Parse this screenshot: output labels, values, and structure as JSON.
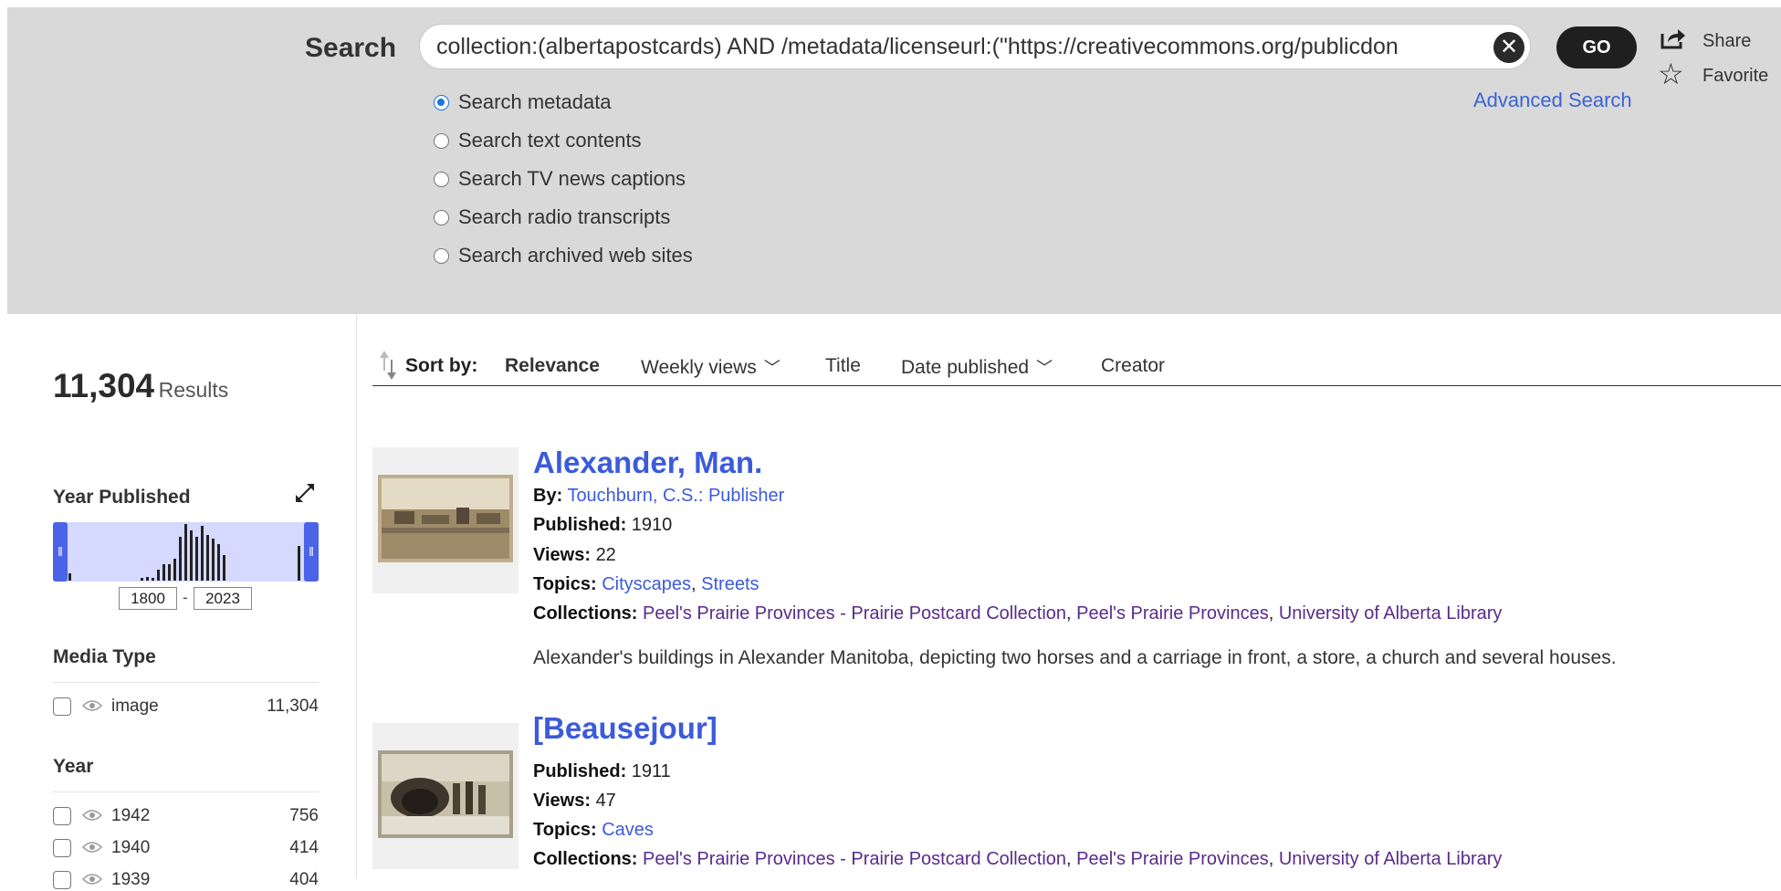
{
  "search": {
    "label": "Search",
    "query": "collection:(albertapostcards) AND /metadata/licenseurl:(\"https://creativecommons.org/publicdon",
    "clear_symbol": "✕",
    "go_label": "GO",
    "share_label": "Share",
    "favorite_label": "Favorite",
    "favorite_symbol": "☆",
    "advanced_label": "Advanced Search",
    "options": [
      {
        "label": "Search metadata",
        "selected": true
      },
      {
        "label": "Search text contents",
        "selected": false
      },
      {
        "label": "Search TV news captions",
        "selected": false
      },
      {
        "label": "Search radio transcripts",
        "selected": false
      },
      {
        "label": "Search archived web sites",
        "selected": false
      }
    ]
  },
  "results": {
    "count": "11,304",
    "label": "Results"
  },
  "facets": {
    "year_published": {
      "title": "Year Published",
      "min": "1800",
      "max": "2023",
      "dash": "-",
      "handle_symbol": "‖"
    },
    "media_type": {
      "title": "Media Type",
      "items": [
        {
          "name": "image",
          "count": "11,304"
        }
      ]
    },
    "year": {
      "title": "Year",
      "items": [
        {
          "name": "1942",
          "count": "756"
        },
        {
          "name": "1940",
          "count": "414"
        },
        {
          "name": "1939",
          "count": "404"
        }
      ]
    }
  },
  "sort": {
    "label": "Sort by:",
    "chevron": "﹀",
    "options": [
      {
        "label": "Relevance",
        "active": true
      },
      {
        "label": "Weekly views",
        "active": false
      },
      {
        "label": "Title",
        "active": false
      },
      {
        "label": "Date published",
        "active": false
      },
      {
        "label": "Creator",
        "active": false
      }
    ]
  },
  "items": [
    {
      "title": "Alexander, Man.",
      "by_label": "By:",
      "by": "Touchburn, C.S.: Publisher",
      "published_label": "Published:",
      "published": "1910",
      "views_label": "Views:",
      "views": "22",
      "topics_label": "Topics:",
      "topics": [
        "Cityscapes",
        "Streets"
      ],
      "collections_label": "Collections:",
      "collections": [
        "Peel's Prairie Provinces - Prairie Postcard Collection",
        "Peel's Prairie Provinces",
        "University of Alberta Library"
      ],
      "description": "Alexander's buildings in Alexander Manitoba, depicting two horses and a carriage in front, a store, a church and several houses."
    },
    {
      "title": "[Beausejour]",
      "published_label": "Published:",
      "published": "1911",
      "views_label": "Views:",
      "views": "47",
      "topics_label": "Topics:",
      "topics": [
        "Caves"
      ],
      "collections_label": "Collections:",
      "collections": [
        "Peel's Prairie Provinces - Prairie Postcard Collection",
        "Peel's Prairie Provinces",
        "University of Alberta Library"
      ]
    }
  ],
  "separator": ", ",
  "colors": {
    "accent": "#3b5bdb",
    "collection_link": "#5a2a8c",
    "histogram_bg": "#d5d9ff",
    "handle": "#4b63e6"
  },
  "icons": [
    "clear-icon",
    "share-icon",
    "star-icon",
    "expand-icon",
    "sort-icon",
    "chevron-down-icon",
    "eye-icon",
    "checkbox-icon"
  ]
}
